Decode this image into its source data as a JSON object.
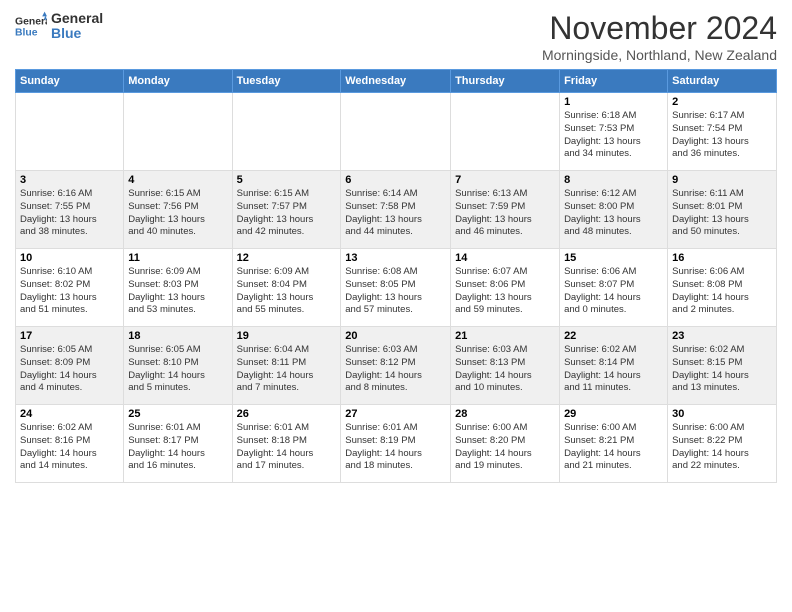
{
  "header": {
    "logo_general": "General",
    "logo_blue": "Blue",
    "title": "November 2024",
    "location": "Morningside, Northland, New Zealand"
  },
  "days_of_week": [
    "Sunday",
    "Monday",
    "Tuesday",
    "Wednesday",
    "Thursday",
    "Friday",
    "Saturday"
  ],
  "weeks": [
    [
      {
        "day": "",
        "info": ""
      },
      {
        "day": "",
        "info": ""
      },
      {
        "day": "",
        "info": ""
      },
      {
        "day": "",
        "info": ""
      },
      {
        "day": "",
        "info": ""
      },
      {
        "day": "1",
        "info": "Sunrise: 6:18 AM\nSunset: 7:53 PM\nDaylight: 13 hours\nand 34 minutes."
      },
      {
        "day": "2",
        "info": "Sunrise: 6:17 AM\nSunset: 7:54 PM\nDaylight: 13 hours\nand 36 minutes."
      }
    ],
    [
      {
        "day": "3",
        "info": "Sunrise: 6:16 AM\nSunset: 7:55 PM\nDaylight: 13 hours\nand 38 minutes."
      },
      {
        "day": "4",
        "info": "Sunrise: 6:15 AM\nSunset: 7:56 PM\nDaylight: 13 hours\nand 40 minutes."
      },
      {
        "day": "5",
        "info": "Sunrise: 6:15 AM\nSunset: 7:57 PM\nDaylight: 13 hours\nand 42 minutes."
      },
      {
        "day": "6",
        "info": "Sunrise: 6:14 AM\nSunset: 7:58 PM\nDaylight: 13 hours\nand 44 minutes."
      },
      {
        "day": "7",
        "info": "Sunrise: 6:13 AM\nSunset: 7:59 PM\nDaylight: 13 hours\nand 46 minutes."
      },
      {
        "day": "8",
        "info": "Sunrise: 6:12 AM\nSunset: 8:00 PM\nDaylight: 13 hours\nand 48 minutes."
      },
      {
        "day": "9",
        "info": "Sunrise: 6:11 AM\nSunset: 8:01 PM\nDaylight: 13 hours\nand 50 minutes."
      }
    ],
    [
      {
        "day": "10",
        "info": "Sunrise: 6:10 AM\nSunset: 8:02 PM\nDaylight: 13 hours\nand 51 minutes."
      },
      {
        "day": "11",
        "info": "Sunrise: 6:09 AM\nSunset: 8:03 PM\nDaylight: 13 hours\nand 53 minutes."
      },
      {
        "day": "12",
        "info": "Sunrise: 6:09 AM\nSunset: 8:04 PM\nDaylight: 13 hours\nand 55 minutes."
      },
      {
        "day": "13",
        "info": "Sunrise: 6:08 AM\nSunset: 8:05 PM\nDaylight: 13 hours\nand 57 minutes."
      },
      {
        "day": "14",
        "info": "Sunrise: 6:07 AM\nSunset: 8:06 PM\nDaylight: 13 hours\nand 59 minutes."
      },
      {
        "day": "15",
        "info": "Sunrise: 6:06 AM\nSunset: 8:07 PM\nDaylight: 14 hours\nand 0 minutes."
      },
      {
        "day": "16",
        "info": "Sunrise: 6:06 AM\nSunset: 8:08 PM\nDaylight: 14 hours\nand 2 minutes."
      }
    ],
    [
      {
        "day": "17",
        "info": "Sunrise: 6:05 AM\nSunset: 8:09 PM\nDaylight: 14 hours\nand 4 minutes."
      },
      {
        "day": "18",
        "info": "Sunrise: 6:05 AM\nSunset: 8:10 PM\nDaylight: 14 hours\nand 5 minutes."
      },
      {
        "day": "19",
        "info": "Sunrise: 6:04 AM\nSunset: 8:11 PM\nDaylight: 14 hours\nand 7 minutes."
      },
      {
        "day": "20",
        "info": "Sunrise: 6:03 AM\nSunset: 8:12 PM\nDaylight: 14 hours\nand 8 minutes."
      },
      {
        "day": "21",
        "info": "Sunrise: 6:03 AM\nSunset: 8:13 PM\nDaylight: 14 hours\nand 10 minutes."
      },
      {
        "day": "22",
        "info": "Sunrise: 6:02 AM\nSunset: 8:14 PM\nDaylight: 14 hours\nand 11 minutes."
      },
      {
        "day": "23",
        "info": "Sunrise: 6:02 AM\nSunset: 8:15 PM\nDaylight: 14 hours\nand 13 minutes."
      }
    ],
    [
      {
        "day": "24",
        "info": "Sunrise: 6:02 AM\nSunset: 8:16 PM\nDaylight: 14 hours\nand 14 minutes."
      },
      {
        "day": "25",
        "info": "Sunrise: 6:01 AM\nSunset: 8:17 PM\nDaylight: 14 hours\nand 16 minutes."
      },
      {
        "day": "26",
        "info": "Sunrise: 6:01 AM\nSunset: 8:18 PM\nDaylight: 14 hours\nand 17 minutes."
      },
      {
        "day": "27",
        "info": "Sunrise: 6:01 AM\nSunset: 8:19 PM\nDaylight: 14 hours\nand 18 minutes."
      },
      {
        "day": "28",
        "info": "Sunrise: 6:00 AM\nSunset: 8:20 PM\nDaylight: 14 hours\nand 19 minutes."
      },
      {
        "day": "29",
        "info": "Sunrise: 6:00 AM\nSunset: 8:21 PM\nDaylight: 14 hours\nand 21 minutes."
      },
      {
        "day": "30",
        "info": "Sunrise: 6:00 AM\nSunset: 8:22 PM\nDaylight: 14 hours\nand 22 minutes."
      }
    ]
  ]
}
